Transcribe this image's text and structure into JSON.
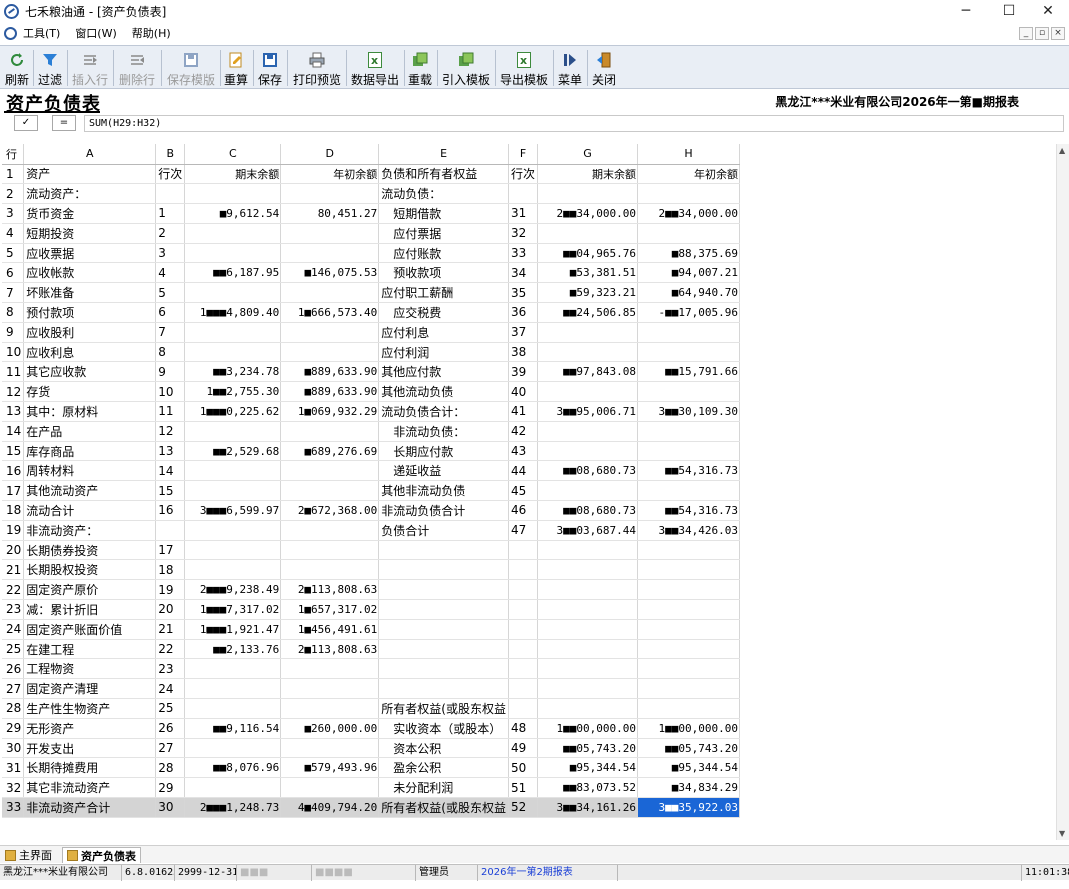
{
  "window": {
    "title": "七禾粮油通 - [资产负债表]",
    "minimize": "─",
    "maximize": "☐",
    "close": "✕"
  },
  "menu": {
    "items": [
      "工具(T)",
      "窗口(W)",
      "帮助(H)"
    ],
    "mdi": [
      "_",
      "▫",
      "×"
    ]
  },
  "toolbar": {
    "buttons": [
      {
        "label": "刷新",
        "icon": "refresh-icon"
      },
      {
        "label": "过滤",
        "icon": "filter-icon"
      },
      {
        "label": "插入行",
        "icon": "insert-row-icon",
        "disabled": true
      },
      {
        "label": "删除行",
        "icon": "delete-row-icon",
        "disabled": true
      },
      {
        "label": "保存模版",
        "icon": "save-template-icon",
        "disabled": true
      },
      {
        "label": "重算",
        "icon": "recalc-icon"
      },
      {
        "label": "保存",
        "icon": "save-icon"
      },
      {
        "label": "打印预览",
        "icon": "print-preview-icon"
      },
      {
        "label": "数据导出",
        "icon": "export-data-icon"
      },
      {
        "label": "重载",
        "icon": "reload-icon"
      },
      {
        "label": "引入模板",
        "icon": "import-template-icon"
      },
      {
        "label": "导出模板",
        "icon": "export-template-icon"
      },
      {
        "label": "菜单",
        "icon": "menu-icon"
      },
      {
        "label": "关闭",
        "icon": "close-icon"
      }
    ]
  },
  "report": {
    "title": "资产负债表",
    "company_period": "黑龙江***米业有限公司2026年一第■期报表"
  },
  "formula": {
    "check_btn": "✓",
    "eq_btn": "=",
    "text": "SUM(H29:H32)"
  },
  "grid": {
    "columns": [
      "行",
      "A",
      "B",
      "C",
      "D",
      "E",
      "F",
      "G",
      "H"
    ],
    "rows": [
      [
        "1",
        "资产",
        "行次",
        "期末余额",
        "年初余额",
        "负债和所有者权益",
        "行次",
        "期末余额",
        "年初余额"
      ],
      [
        "2",
        "流动资产：",
        "",
        "",
        "",
        "流动负债：",
        "",
        "",
        ""
      ],
      [
        "3",
        "货币资金",
        "1",
        "■9,612.54",
        "80,451.27",
        "短期借款",
        "31",
        "2■■34,000.00",
        "2■■34,000.00"
      ],
      [
        "4",
        "短期投资",
        "2",
        "",
        "",
        "应付票据",
        "32",
        "",
        ""
      ],
      [
        "5",
        "应收票据",
        "3",
        "",
        "",
        "应付账款",
        "33",
        "■■04,965.76",
        "■88,375.69"
      ],
      [
        "6",
        "应收帐款",
        "4",
        "■■6,187.95",
        "■146,075.53",
        "预收款项",
        "34",
        "■53,381.51",
        "■94,007.21"
      ],
      [
        "7",
        "坏账准备",
        "5",
        "",
        "",
        "应付职工薪酬",
        "35",
        "■59,323.21",
        "■64,940.70"
      ],
      [
        "8",
        "预付款项",
        "6",
        "1■■■4,809.40",
        "1■666,573.40",
        "应交税费",
        "36",
        "■■24,506.85",
        "-■■17,005.96"
      ],
      [
        "9",
        "应收股利",
        "7",
        "",
        "",
        "应付利息",
        "37",
        "",
        ""
      ],
      [
        "10",
        "应收利息",
        "8",
        "",
        "",
        "应付利润",
        "38",
        "",
        ""
      ],
      [
        "11",
        "其它应收款",
        "9",
        "■■3,234.78",
        "■889,633.90",
        "其他应付款",
        "39",
        "■■97,843.08",
        "■■15,791.66"
      ],
      [
        "12",
        "存货",
        "10",
        "1■■2,755.30",
        "■889,633.90",
        "其他流动负债",
        "40",
        "",
        ""
      ],
      [
        "13",
        "其中：原材料",
        "11",
        "1■■■0,225.62",
        "1■069,932.29",
        "流动负债合计：",
        "41",
        "3■■95,006.71",
        "3■■30,109.30"
      ],
      [
        "14",
        "在产品",
        "12",
        "",
        "",
        "非流动负债：",
        "42",
        "",
        ""
      ],
      [
        "15",
        "库存商品",
        "13",
        "■■2,529.68",
        "■689,276.69",
        "长期应付款",
        "43",
        "",
        ""
      ],
      [
        "16",
        "周转材料",
        "14",
        "",
        "",
        "递延收益",
        "44",
        "■■08,680.73",
        "■■54,316.73"
      ],
      [
        "17",
        "其他流动资产",
        "15",
        "",
        "",
        "其他非流动负债",
        "45",
        "",
        ""
      ],
      [
        "18",
        "流动合计",
        "16",
        "3■■■6,599.97",
        "2■672,368.00",
        "非流动负债合计",
        "46",
        "■■08,680.73",
        "■■54,316.73"
      ],
      [
        "19",
        "非流动资产：",
        "",
        "",
        "",
        "负债合计",
        "47",
        "3■■03,687.44",
        "3■■34,426.03"
      ],
      [
        "20",
        "长期债券投资",
        "17",
        "",
        "",
        "",
        "",
        "",
        ""
      ],
      [
        "21",
        "长期股权投资",
        "18",
        "",
        "",
        "",
        "",
        "",
        ""
      ],
      [
        "22",
        "固定资产原价",
        "19",
        "2■■■9,238.49",
        "2■113,808.63",
        "",
        "",
        "",
        ""
      ],
      [
        "23",
        "减：累计折旧",
        "20",
        "1■■■7,317.02",
        "1■657,317.02",
        "",
        "",
        "",
        ""
      ],
      [
        "24",
        "固定资产账面价值",
        "21",
        "1■■■1,921.47",
        "1■456,491.61",
        "",
        "",
        "",
        ""
      ],
      [
        "25",
        "在建工程",
        "22",
        "■■2,133.76",
        "2■113,808.63",
        "",
        "",
        "",
        ""
      ],
      [
        "26",
        "工程物资",
        "23",
        "",
        "",
        "",
        "",
        "",
        ""
      ],
      [
        "27",
        "固定资产清理",
        "24",
        "",
        "",
        "",
        "",
        "",
        ""
      ],
      [
        "28",
        "生产性生物资产",
        "25",
        "",
        "",
        "所有者权益(或股东权益",
        "",
        "",
        ""
      ],
      [
        "29",
        "无形资产",
        "26",
        "■■9,116.54",
        "■260,000.00",
        "实收资本（或股本）",
        "48",
        "1■■00,000.00",
        "1■■00,000.00"
      ],
      [
        "30",
        "开发支出",
        "27",
        "",
        "",
        "资本公积",
        "49",
        "■■05,743.20",
        "■■05,743.20"
      ],
      [
        "31",
        "长期待摊费用",
        "28",
        "■■8,076.96",
        "■579,493.96",
        "盈余公积",
        "50",
        "■95,344.54",
        "■95,344.54"
      ],
      [
        "32",
        "其它非流动资产",
        "29",
        "",
        "",
        "未分配利润",
        "51",
        "■■83,073.52",
        "■34,834.29"
      ],
      [
        "33",
        "非流动资产合计",
        "30",
        "2■■■1,248.73",
        "4■409,794.20",
        "所有者权益(或股东权益",
        "52",
        "3■■34,161.26",
        "3■■35,922.03"
      ]
    ]
  },
  "tabs": [
    "主界面",
    "资产负债表"
  ],
  "status": {
    "company": "黑龙江***米业有限公司",
    "version": "6.8.01623",
    "date": "2999-12-31",
    "field4": "■■■",
    "field5": "■■■■",
    "user": "管理员",
    "period": "2026年一第2期报表",
    "time": "11:01:38"
  },
  "colors": {
    "toolbar_bg": "#e9eef5",
    "selection": "#1a66d6",
    "status_blue": "#1a3fd6"
  }
}
